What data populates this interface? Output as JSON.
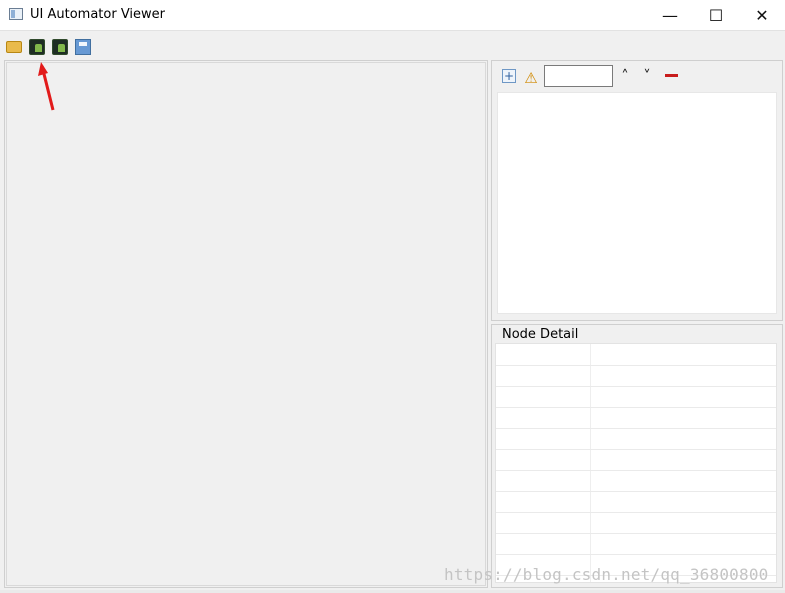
{
  "window": {
    "title": "UI Automator Viewer",
    "minimize_glyph": "—",
    "maximize_glyph": "☐",
    "close_glyph": "✕"
  },
  "toolbar": {
    "buttons": [
      {
        "name": "open-icon",
        "icon": "folder-open-icon"
      },
      {
        "name": "device-screenshot-button",
        "icon": "device-screenshot-icon"
      },
      {
        "name": "device-screenshot-compressed-button",
        "icon": "device-screenshot-compressed-icon"
      },
      {
        "name": "save-button",
        "icon": "save-icon"
      }
    ]
  },
  "tree_panel": {
    "expand_glyph": "+",
    "warning_glyph": "⚠",
    "search_value": "",
    "up_glyph": "˄",
    "down_glyph": "˅"
  },
  "node_detail": {
    "title": "Node Detail",
    "rows": 11
  },
  "watermark": {
    "text": "https://blog.csdn.net/qq_36800800"
  },
  "colors": {
    "window_bg": "#f0f0f0",
    "title_bg": "#ffffff",
    "annotation_arrow": "#e21b1b",
    "clear_button": "#c81c1c"
  }
}
